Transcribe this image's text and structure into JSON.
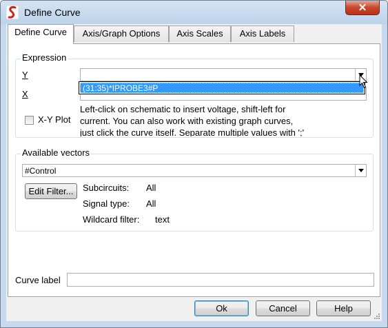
{
  "window": {
    "title": "Define Curve",
    "close_symbol": "✕"
  },
  "tabs": [
    {
      "label": "Define Curve",
      "active": true
    },
    {
      "label": "Axis/Graph Options",
      "active": false
    },
    {
      "label": "Axis Scales",
      "active": false
    },
    {
      "label": "Axis Labels",
      "active": false
    }
  ],
  "expression": {
    "group_label": "Expression",
    "y_label": "Y",
    "x_label": "X",
    "y_value": "",
    "dropdown_item": "(31:35)*IPROBE3#P",
    "xy_plot_label": "X-Y Plot",
    "xy_plot_checked": false,
    "help_text_1": "Left-click on schematic to insert voltage, shift-left for",
    "help_text_2": "current. You can also work with existing graph curves,",
    "help_text_3": "just click the curve itself. Separate multiple values with ';'"
  },
  "vectors": {
    "group_label": "Available vectors",
    "selected": "#Control",
    "edit_filter_label": "Edit Filter...",
    "subcircuits_label": "Subcircuits:",
    "subcircuits_value": "All",
    "signal_type_label": "Signal type:",
    "signal_type_value": "All",
    "wildcard_label": "Wildcard filter:",
    "wildcard_value": "text"
  },
  "curve_label": {
    "label": "Curve label",
    "value": ""
  },
  "buttons": {
    "ok": "Ok",
    "cancel": "Cancel",
    "help": "Help"
  },
  "colors": {
    "selection": "#3399ff",
    "title_bar": "#c6d9ee",
    "close_button": "#c8452e"
  },
  "icons": {
    "app": "simetrix-logo-icon",
    "close": "close-icon",
    "dropdown": "chevron-down-icon",
    "cursor": "mouse-pointer-icon",
    "grip": "resize-grip-icon"
  }
}
